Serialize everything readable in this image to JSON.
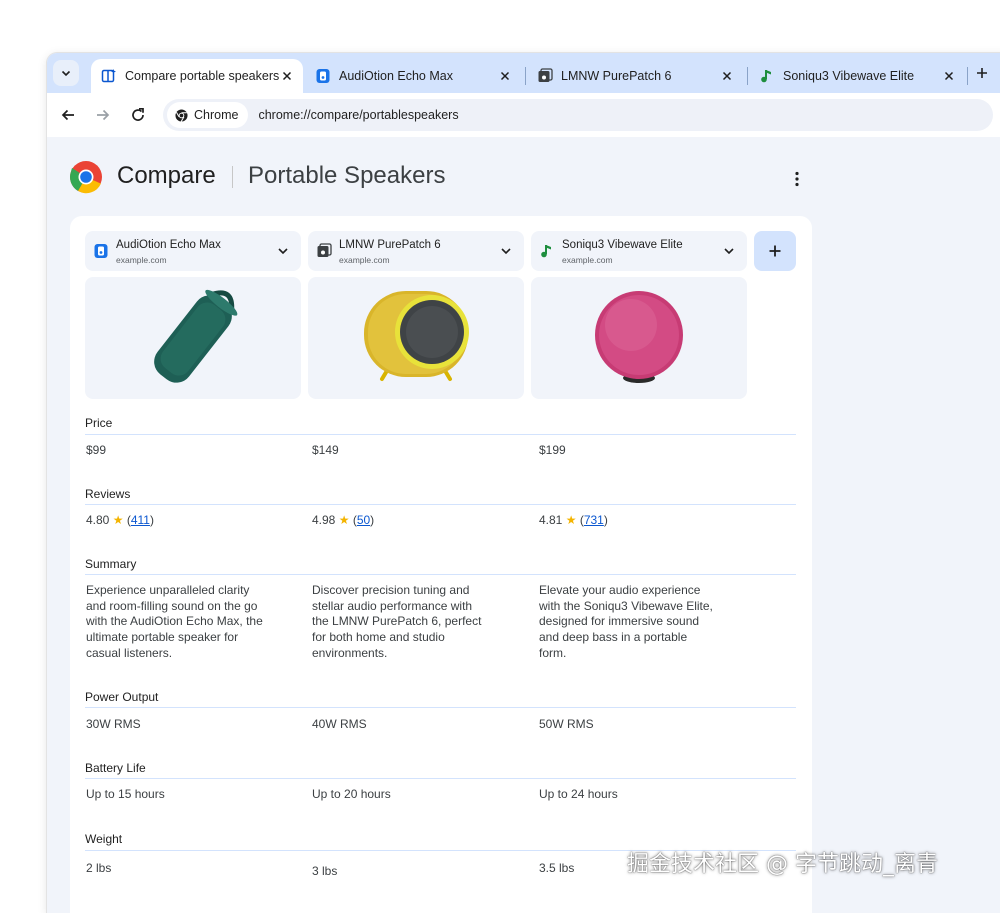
{
  "tabs": [
    {
      "title": "Compare portable speakers",
      "favicon": "compare-icon",
      "active": true
    },
    {
      "title": "AudiOtion Echo Max",
      "favicon": "audiotion-icon",
      "active": false
    },
    {
      "title": "LMNW PurePatch 6",
      "favicon": "lmnw-icon",
      "active": false
    },
    {
      "title": "Soniqu3 Vibewave Elite",
      "favicon": "music-note-icon",
      "active": false
    }
  ],
  "omnibox": {
    "chip_label": "Chrome",
    "url": "chrome://compare/portablespeakers"
  },
  "header": {
    "title": "Compare",
    "subtitle": "Portable Speakers"
  },
  "products": [
    {
      "name": "AudiOtion Echo Max",
      "domain": "example.com",
      "image": "teal-cylinder-speaker"
    },
    {
      "name": "LMNW PurePatch 6",
      "domain": "example.com",
      "image": "yellow-round-speaker"
    },
    {
      "name": "Soniqu3 Vibewave Elite",
      "domain": "example.com",
      "image": "pink-sphere-speaker"
    }
  ],
  "rows": {
    "price": {
      "label": "Price",
      "values": [
        "$99",
        "$149",
        "$199"
      ]
    },
    "reviews": {
      "label": "Reviews",
      "values": [
        {
          "rating": "4.80",
          "star": "★",
          "count": "411"
        },
        {
          "rating": "4.98",
          "star": "★",
          "count": "50"
        },
        {
          "rating": "4.81",
          "star": "★",
          "count": "731"
        }
      ]
    },
    "summary": {
      "label": "Summary",
      "values": [
        [
          "Experience unparalleled clarity",
          "and room-filling sound on the go",
          "with the AudiOtion Echo Max, the",
          "ultimate portable speaker for",
          "casual listeners."
        ],
        [
          "Discover precision tuning and",
          "stellar audio performance with",
          "the LMNW PurePatch 6, perfect",
          "for both home and studio",
          "environments."
        ],
        [
          "Elevate your audio experience",
          "with the Soniqu3 Vibewave Elite,",
          "designed for immersive sound",
          "and deep bass in a portable",
          "form."
        ]
      ]
    },
    "power": {
      "label": "Power Output",
      "values": [
        "30W RMS",
        "40W RMS",
        "50W RMS"
      ]
    },
    "battery": {
      "label": "Battery Life",
      "values": [
        "Up to 15 hours",
        "Up to 20 hours",
        "Up to 24 hours"
      ]
    },
    "weight": {
      "label": "Weight",
      "values": [
        "2 lbs",
        "3 lbs",
        "3.5 lbs"
      ]
    }
  },
  "watermark": "掘金技术社区 @ 字节跳动_离青",
  "colors": {
    "tabstrip": "#d3e3fd",
    "page_bg": "#f1f4fa",
    "link": "#0b57d0",
    "star": "#f4b400",
    "add_button": "#d3e3fd"
  }
}
